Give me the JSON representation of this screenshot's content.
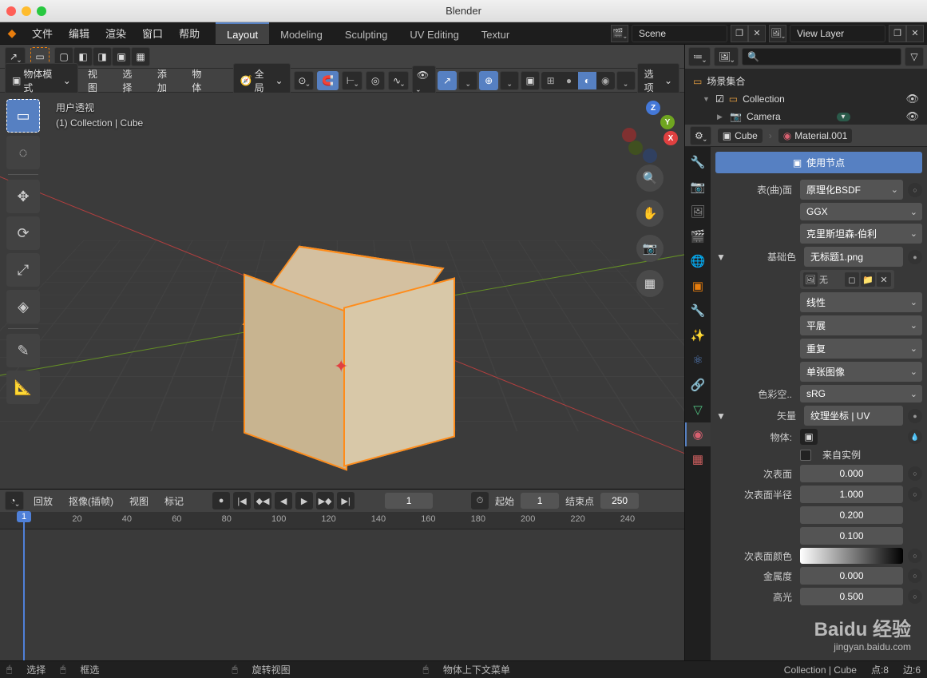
{
  "app_title": "Blender",
  "menu": {
    "file": "文件",
    "edit": "编辑",
    "render": "渲染",
    "window": "窗口",
    "help": "帮助"
  },
  "workspaces": [
    "Layout",
    "Modeling",
    "Sculpting",
    "UV Editing",
    "Textur"
  ],
  "active_workspace": "Layout",
  "scene_name": "Scene",
  "view_layer": "View Layer",
  "viewport": {
    "mode": "物体模式",
    "menus": {
      "view": "视图",
      "select": "选择",
      "add": "添加",
      "object": "物体"
    },
    "pivot": "全局",
    "options_label": "选项",
    "overlay_line1": "用户透视",
    "overlay_line2": "(1) Collection | Cube"
  },
  "outliner": {
    "scene_collection": "场景集合",
    "collection": "Collection",
    "items": [
      "Camera"
    ]
  },
  "props_header": {
    "object": "Cube",
    "material": "Material.001"
  },
  "material": {
    "use_nodes": "使用节点",
    "rows": [
      {
        "label": "表(曲)面",
        "value": "原理化BSDF",
        "type": "dd_dot"
      },
      {
        "label": "",
        "value": "GGX",
        "type": "dd"
      },
      {
        "label": "",
        "value": "克里斯坦森-伯利",
        "type": "dd"
      },
      {
        "label": "基础色",
        "value": "无标题1.png",
        "type": "dot_expand"
      },
      {
        "label": "",
        "value": "无",
        "type": "img_browse"
      },
      {
        "label": "",
        "value": "线性",
        "type": "dd"
      },
      {
        "label": "",
        "value": "平展",
        "type": "dd"
      },
      {
        "label": "",
        "value": "重复",
        "type": "dd"
      },
      {
        "label": "",
        "value": "单张图像",
        "type": "dd"
      },
      {
        "label": "色彩空..",
        "value": "sRG",
        "type": "dd"
      },
      {
        "label": "矢量",
        "value": "纹理坐标 | UV",
        "type": "dot_expand"
      },
      {
        "label": "物体:",
        "value": "",
        "type": "obj_picker"
      },
      {
        "label": "",
        "value": "来自实例",
        "type": "check"
      },
      {
        "label": "次表面",
        "value": "0.000",
        "type": "num_dot"
      },
      {
        "label": "次表面半径",
        "value": "1.000",
        "type": "num_dot"
      },
      {
        "label": "",
        "value": "0.200",
        "type": "num"
      },
      {
        "label": "",
        "value": "0.100",
        "type": "num"
      },
      {
        "label": "次表面颜色",
        "value": "",
        "type": "color_dot"
      },
      {
        "label": "金属度",
        "value": "0.000",
        "type": "num_dot"
      },
      {
        "label": "高光",
        "value": "0.500",
        "type": "num_dot"
      }
    ]
  },
  "timeline": {
    "playback": "回放",
    "keying": "抠像(插帧)",
    "view": "视图",
    "marker": "标记",
    "current": 1,
    "start_lbl": "起始",
    "start": 1,
    "end_lbl": "结束点",
    "end": 250,
    "ticks": [
      20,
      40,
      60,
      80,
      100,
      120,
      140,
      160,
      180,
      200,
      220,
      240
    ]
  },
  "statusbar": {
    "select": "选择",
    "box": "框选",
    "rotate": "旋转视图",
    "context": "物体上下文菜单",
    "path": "Collection | Cube",
    "verts": "点:8",
    "edges": "边:6"
  },
  "watermark": {
    "brand": "Baidu 经验",
    "url": "jingyan.baidu.com"
  }
}
